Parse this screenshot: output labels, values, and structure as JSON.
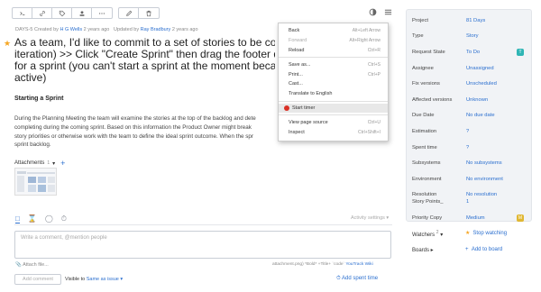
{
  "issue": {
    "id": "DAYS-5",
    "created_label": "Created by",
    "created_by": "H G Wells",
    "created_ago": "2 years ago",
    "updated_label": "Updated by",
    "updated_by": "Ray Bradbury",
    "updated_ago": "2 years ago",
    "title_lines": [
      "As a team, I'd like to commit to a set of stories to be com",
      "iteration) >> Click \"Create Sprint\" then drag the footer d",
      "for a sprint (you can't start a sprint at the moment becau",
      "active)"
    ],
    "section_heading": "Starting a Sprint",
    "description_lines": [
      "During the Planning Meeting the team will examine the stories at the top of the backlog and dete",
      "completing during the coming sprint. Based on this information the Product Owner might break",
      "story priorities or otherwise work with the team to define the ideal sprint outcome. When the spr",
      "sprint backlog."
    ]
  },
  "attachments": {
    "label": "Attachments",
    "count": "1",
    "caret": "▾",
    "add": "+"
  },
  "activity_settings": "Activity settings ▾",
  "comment": {
    "placeholder": "Write a comment, @mention people",
    "attach_file": "Attach file...",
    "formatting_prefix": "attachment.png) *Bold* +Title+ `code`",
    "formatting_link": "YouTrack Wiki",
    "add_button": "Add comment",
    "visible_label": "Visible to",
    "visible_value": "Same as issue ▾",
    "add_spent_time": "Add spent time"
  },
  "context_menu": {
    "group1": [
      {
        "label": "Back",
        "shortcut": "Alt+Left Arrow",
        "disabled": false
      },
      {
        "label": "Forward",
        "shortcut": "Alt+Right Arrow",
        "disabled": true
      },
      {
        "label": "Reload",
        "shortcut": "Ctrl+R",
        "disabled": false
      }
    ],
    "group2": [
      {
        "label": "Save as...",
        "shortcut": "Ctrl+S"
      },
      {
        "label": "Print...",
        "shortcut": "Ctrl+P"
      },
      {
        "label": "Cast...",
        "shortcut": ""
      },
      {
        "label": "Translate to English",
        "shortcut": ""
      }
    ],
    "timer": "Start timer",
    "group3": [
      {
        "label": "View page source",
        "shortcut": "Ctrl+U"
      },
      {
        "label": "Inspect",
        "shortcut": "Ctrl+Shift+I"
      }
    ]
  },
  "fields": [
    {
      "key": "Project",
      "value": "81 Days"
    },
    {
      "key": "Type",
      "value": "Story"
    },
    {
      "key": "Request State",
      "value": "To Do",
      "badge": "T",
      "badge_color": "#2fb5b5"
    },
    {
      "key": "Assignee",
      "value": "Unassigned"
    },
    {
      "key": "Fix versions",
      "value": "Unscheduled"
    },
    {
      "key": "Affected versions",
      "value": "Unknown"
    },
    {
      "key": "Due Date",
      "value": "No due date"
    },
    {
      "key": "Estimation",
      "value": "?"
    },
    {
      "key": "Spent time",
      "value": "?"
    },
    {
      "key": "Subsystems",
      "value": "No subsystems"
    },
    {
      "key": "Environment",
      "value": "No environment"
    },
    {
      "key": "Resolution",
      "value": "No resolution"
    },
    {
      "key": "Story Points_",
      "value": "1"
    },
    {
      "key": "Priority Copy",
      "value": "Medium",
      "badge": "M",
      "badge_color": "#e0b732"
    }
  ],
  "watchers": {
    "label": "Watchers",
    "count": "2",
    "action": "Stop watching"
  },
  "boards": {
    "label": "Boards",
    "action": "Add to board"
  },
  "colors": {
    "accent": "#2b6fcf",
    "star": "#f5a623",
    "timer": "#d93025"
  }
}
